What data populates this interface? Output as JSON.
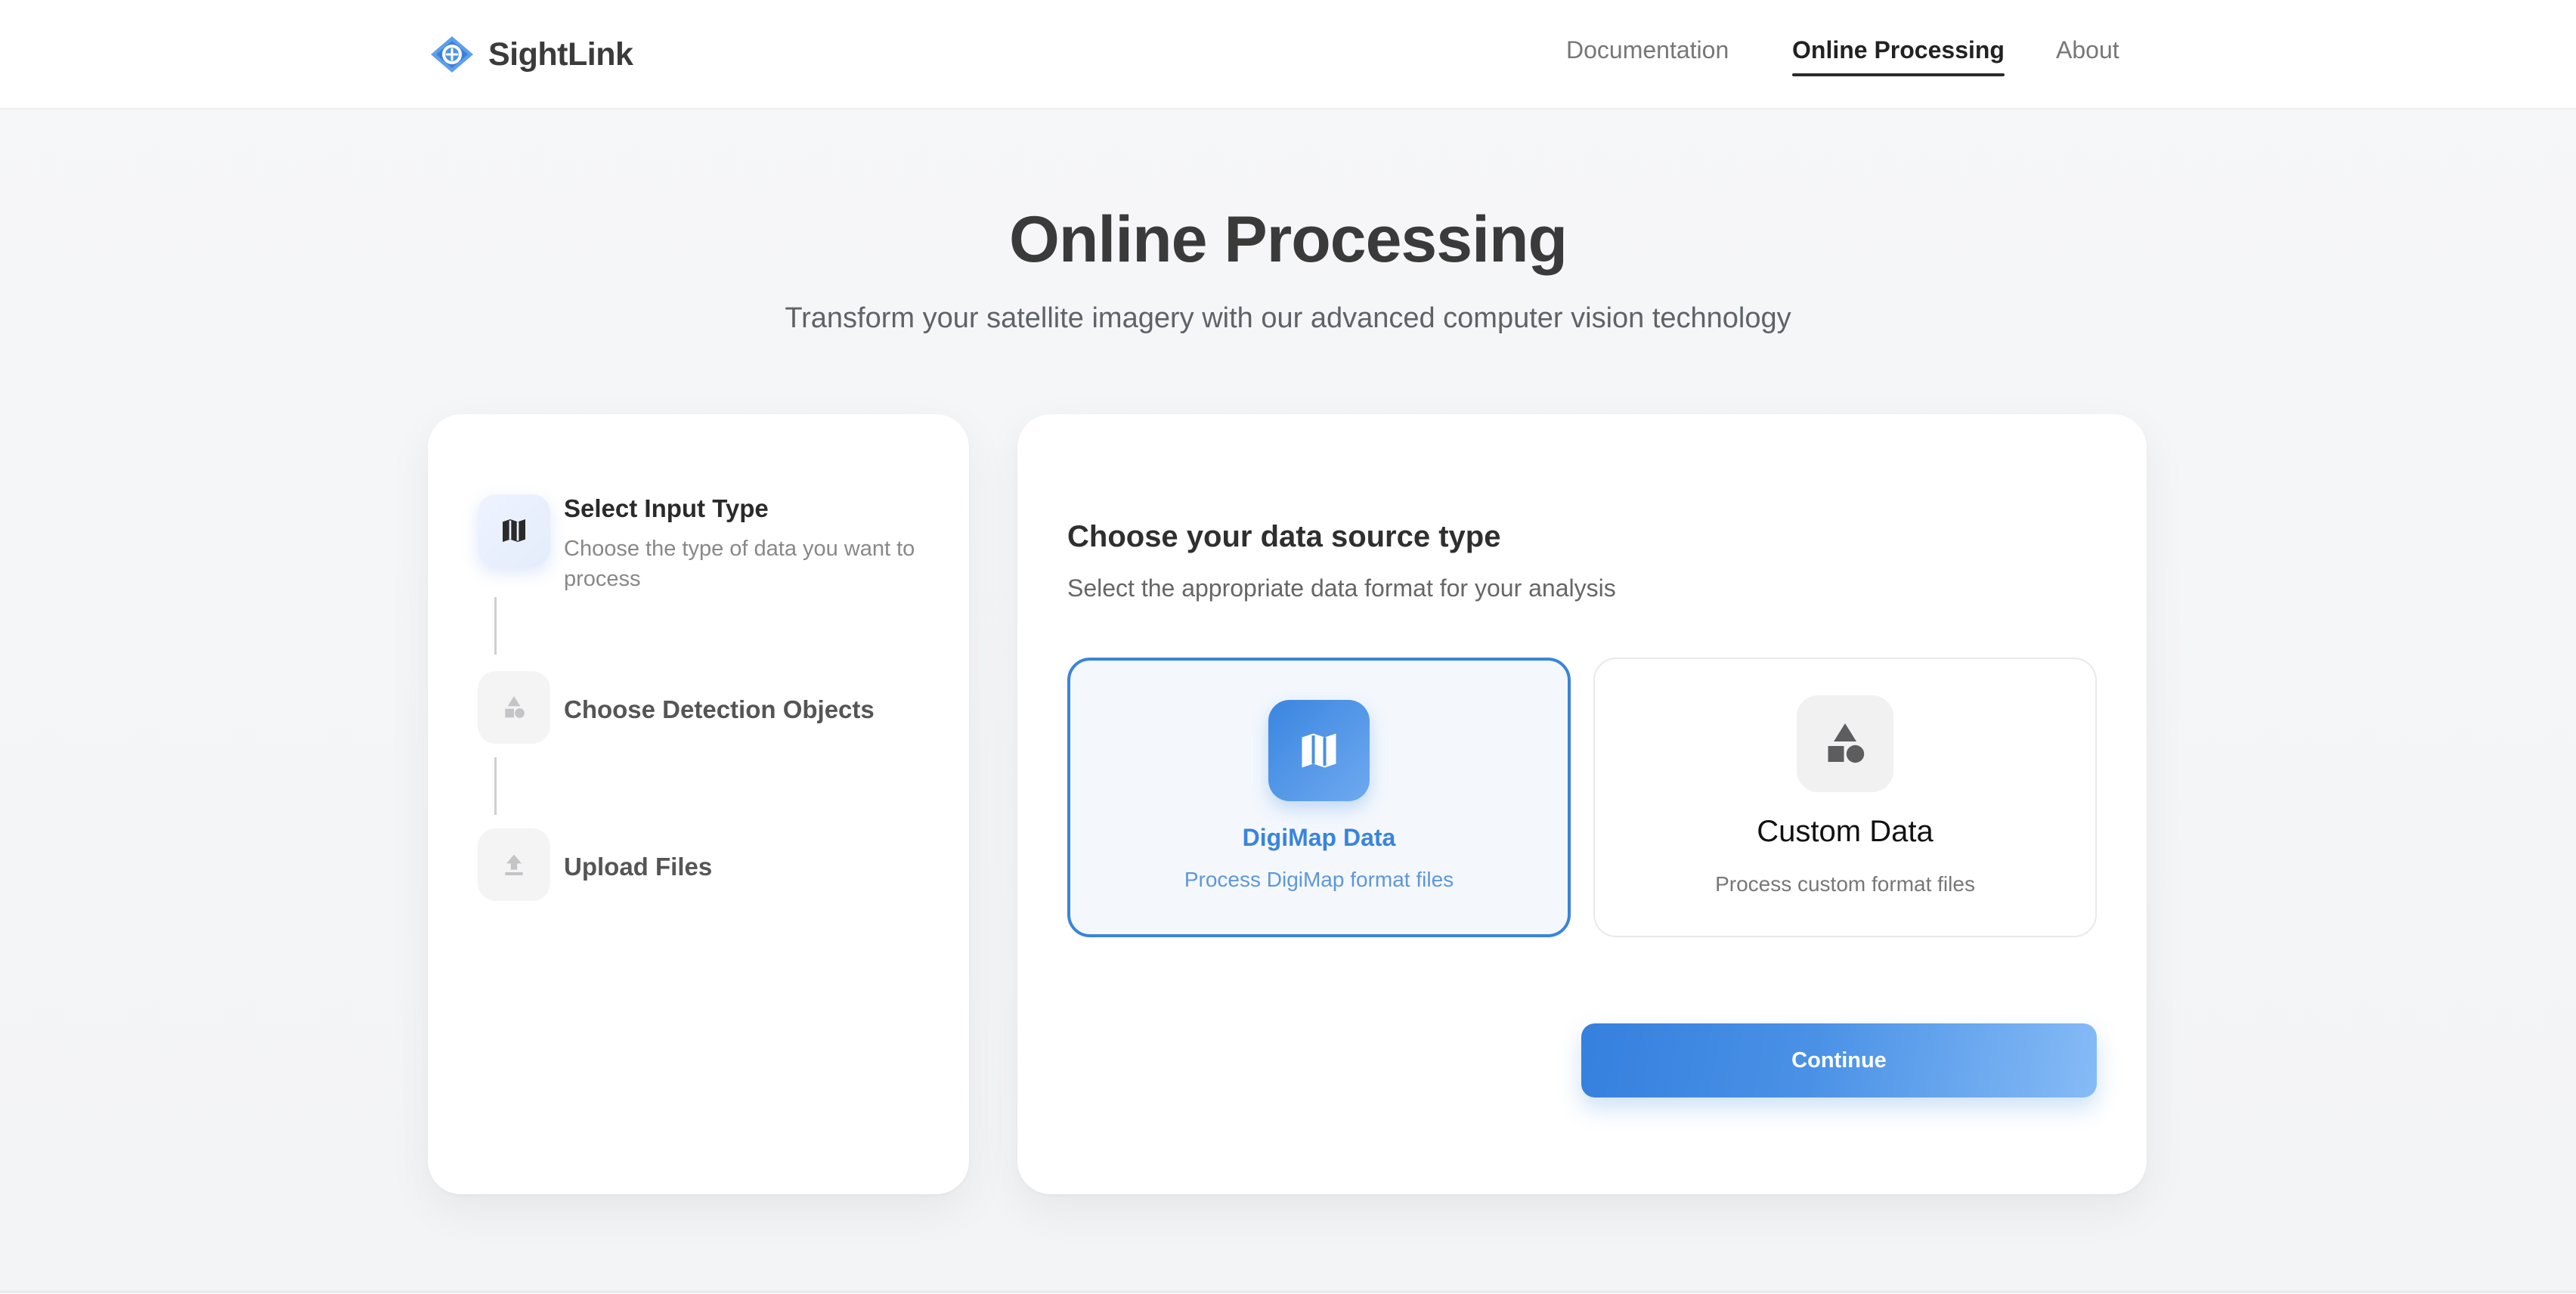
{
  "header": {
    "brand": "SightLink",
    "nav": [
      {
        "label": "Documentation",
        "active": false
      },
      {
        "label": "Online Processing",
        "active": true
      },
      {
        "label": "About",
        "active": false
      }
    ]
  },
  "hero": {
    "title": "Online Processing",
    "subtitle": "Transform your satellite imagery with our advanced computer vision technology"
  },
  "steps": [
    {
      "title": "Select Input Type",
      "description": "Choose the type of data you want to process",
      "icon": "map-icon",
      "active": true
    },
    {
      "title": "Choose Detection Objects",
      "description": "",
      "icon": "shapes-icon",
      "active": false
    },
    {
      "title": "Upload Files",
      "description": "",
      "icon": "upload-icon",
      "active": false
    }
  ],
  "main": {
    "heading": "Choose your data source type",
    "subheading": "Select the appropriate data format for your analysis",
    "options": [
      {
        "title": "DigiMap Data",
        "description": "Process DigiMap format files",
        "icon": "map-icon",
        "selected": true
      },
      {
        "title": "Custom Data",
        "description": "Process custom format files",
        "icon": "shapes-icon",
        "selected": false
      }
    ],
    "continue_label": "Continue"
  },
  "colors": {
    "accent": "#3a84dc",
    "accent_light": "#86bbf6",
    "text_dark": "#2f2f2f",
    "text_muted": "#888888"
  }
}
